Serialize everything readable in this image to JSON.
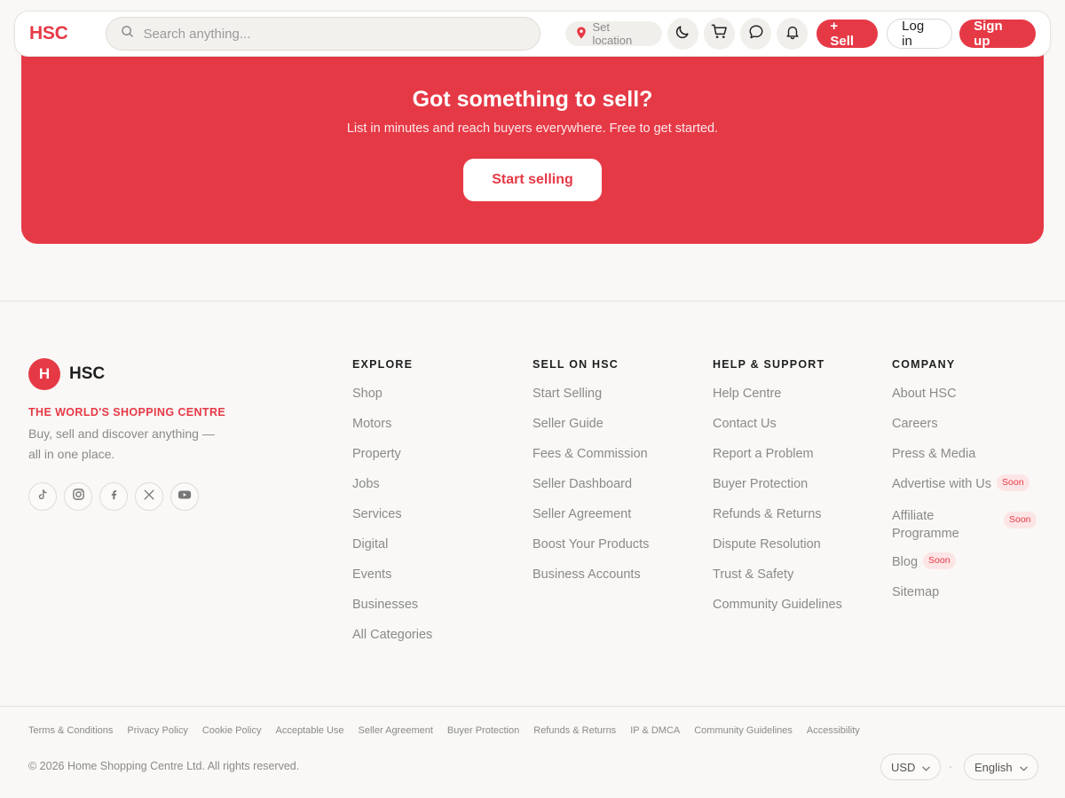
{
  "header": {
    "logo": "HSC",
    "search_placeholder": "Search anything...",
    "location_label": "Set location",
    "sell_label": "+ Sell",
    "login_label": "Log in",
    "signup_label": "Sign up",
    "icons": [
      "moon-icon",
      "cart-icon",
      "chat-icon",
      "bell-icon"
    ]
  },
  "banner": {
    "title": "Got something to sell?",
    "subtitle": "List in minutes and reach buyers everywhere. Free to get started.",
    "cta": "Start selling"
  },
  "brand": {
    "initial": "H",
    "name": "HSC",
    "tagline": "THE WORLD'S SHOPPING CENTRE",
    "description": "Buy, sell and discover anything — all in one place.",
    "socials": [
      "tiktok-icon",
      "instagram-icon",
      "facebook-icon",
      "x-icon",
      "youtube-icon"
    ]
  },
  "columns": {
    "explore": {
      "title": "EXPLORE",
      "items": [
        "Shop",
        "Motors",
        "Property",
        "Jobs",
        "Services",
        "Digital",
        "Events",
        "Businesses",
        "All Categories"
      ]
    },
    "sell": {
      "title": "SELL ON HSC",
      "items": [
        "Start Selling",
        "Seller Guide",
        "Fees & Commission",
        "Seller Dashboard",
        "Seller Agreement",
        "Boost Your Products",
        "Business Accounts"
      ]
    },
    "help": {
      "title": "HELP & SUPPORT",
      "items": [
        "Help Centre",
        "Contact Us",
        "Report a Problem",
        "Buyer Protection",
        "Refunds & Returns",
        "Dispute Resolution",
        "Trust & Safety",
        "Community Guidelines"
      ]
    },
    "company": {
      "title": "COMPANY",
      "items": [
        "About HSC",
        "Careers",
        "Press & Media",
        "Advertise with Us",
        "Affiliate Programme",
        "Blog",
        "Sitemap"
      ],
      "soon_label": "Soon"
    }
  },
  "legal_links": [
    "Terms & Conditions",
    "Privacy Policy",
    "Cookie Policy",
    "Acceptable Use",
    "Seller Agreement",
    "Buyer Protection",
    "Refunds & Returns",
    "IP & DMCA",
    "Community Guidelines",
    "Accessibility"
  ],
  "copyright": "© 2026 Home Shopping Centre Ltd. All rights reserved.",
  "currency": "USD",
  "language": "English",
  "colors": {
    "accent": "#e63946",
    "background": "#f9f8f6",
    "muted_text": "#8a8a8a"
  }
}
